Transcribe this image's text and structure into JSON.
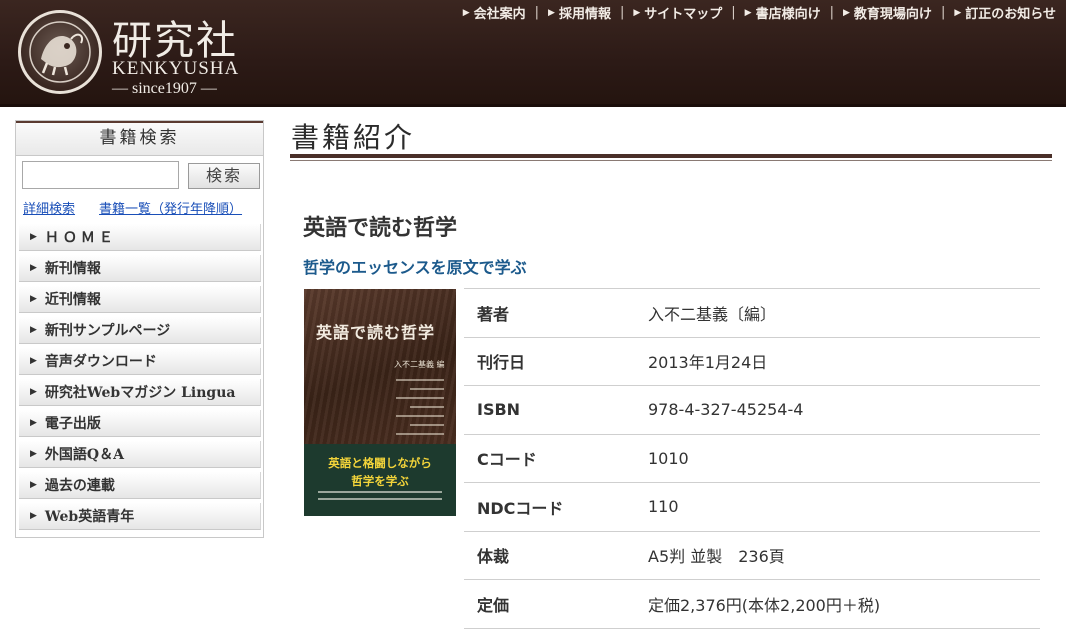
{
  "header": {
    "logo_kanji": "研究社",
    "logo_roman": "KENKYUSHA",
    "logo_since": "— since1907 —",
    "nav": [
      {
        "label": "会社案内"
      },
      {
        "label": "採用情報"
      },
      {
        "label": "サイトマップ"
      },
      {
        "label": "書店様向け"
      },
      {
        "label": "教育現場向け"
      },
      {
        "label": "訂正のお知らせ"
      }
    ]
  },
  "sidebar": {
    "title": "書籍検索",
    "search_button": "検索",
    "search_value": "",
    "links": [
      "詳細検索",
      "書籍一覧（発行年降順）"
    ],
    "menu": [
      {
        "label": "ＨＯＭＥ"
      },
      {
        "label": "新刊情報"
      },
      {
        "label": "近刊情報"
      },
      {
        "label": "新刊サンプルページ"
      },
      {
        "label": "音声ダウンロード"
      },
      {
        "label": "研究社Webマガジン Lingua"
      },
      {
        "label": "電子出版"
      },
      {
        "label": "外国語Q＆A"
      },
      {
        "label": "過去の連載"
      },
      {
        "label": "Web英語青年"
      }
    ]
  },
  "main": {
    "section_title": "書籍紹介",
    "book_title": "英語で読む哲学",
    "book_subtitle": "哲学のエッセンスを原文で学ぶ",
    "cover": {
      "title": "英語で読む哲学",
      "editor": "入不二基義 編",
      "band_line1": "英語と格闘しながら",
      "band_line2": "哲学を学ぶ"
    },
    "details": [
      {
        "key": "著者",
        "value": "入不二基義〔編〕"
      },
      {
        "key": "刊行日",
        "value": "2013年1月24日"
      },
      {
        "key": "ISBN",
        "value": "978-4-327-45254-4"
      },
      {
        "key": "Cコード",
        "value": "1010"
      },
      {
        "key": "NDCコード",
        "value": "110"
      },
      {
        "key": "体裁",
        "value": "A5判 並製　236頁"
      },
      {
        "key": "定価",
        "value": "定価2,376円(本体2,200円＋税)"
      }
    ]
  },
  "colors": {
    "header_bg": "#2c1a16",
    "subtitle_blue": "#1c5a8c",
    "link_blue": "#1a4fb8",
    "cover_band": "#1d3a2e",
    "cover_band_text": "#f3d43a"
  }
}
